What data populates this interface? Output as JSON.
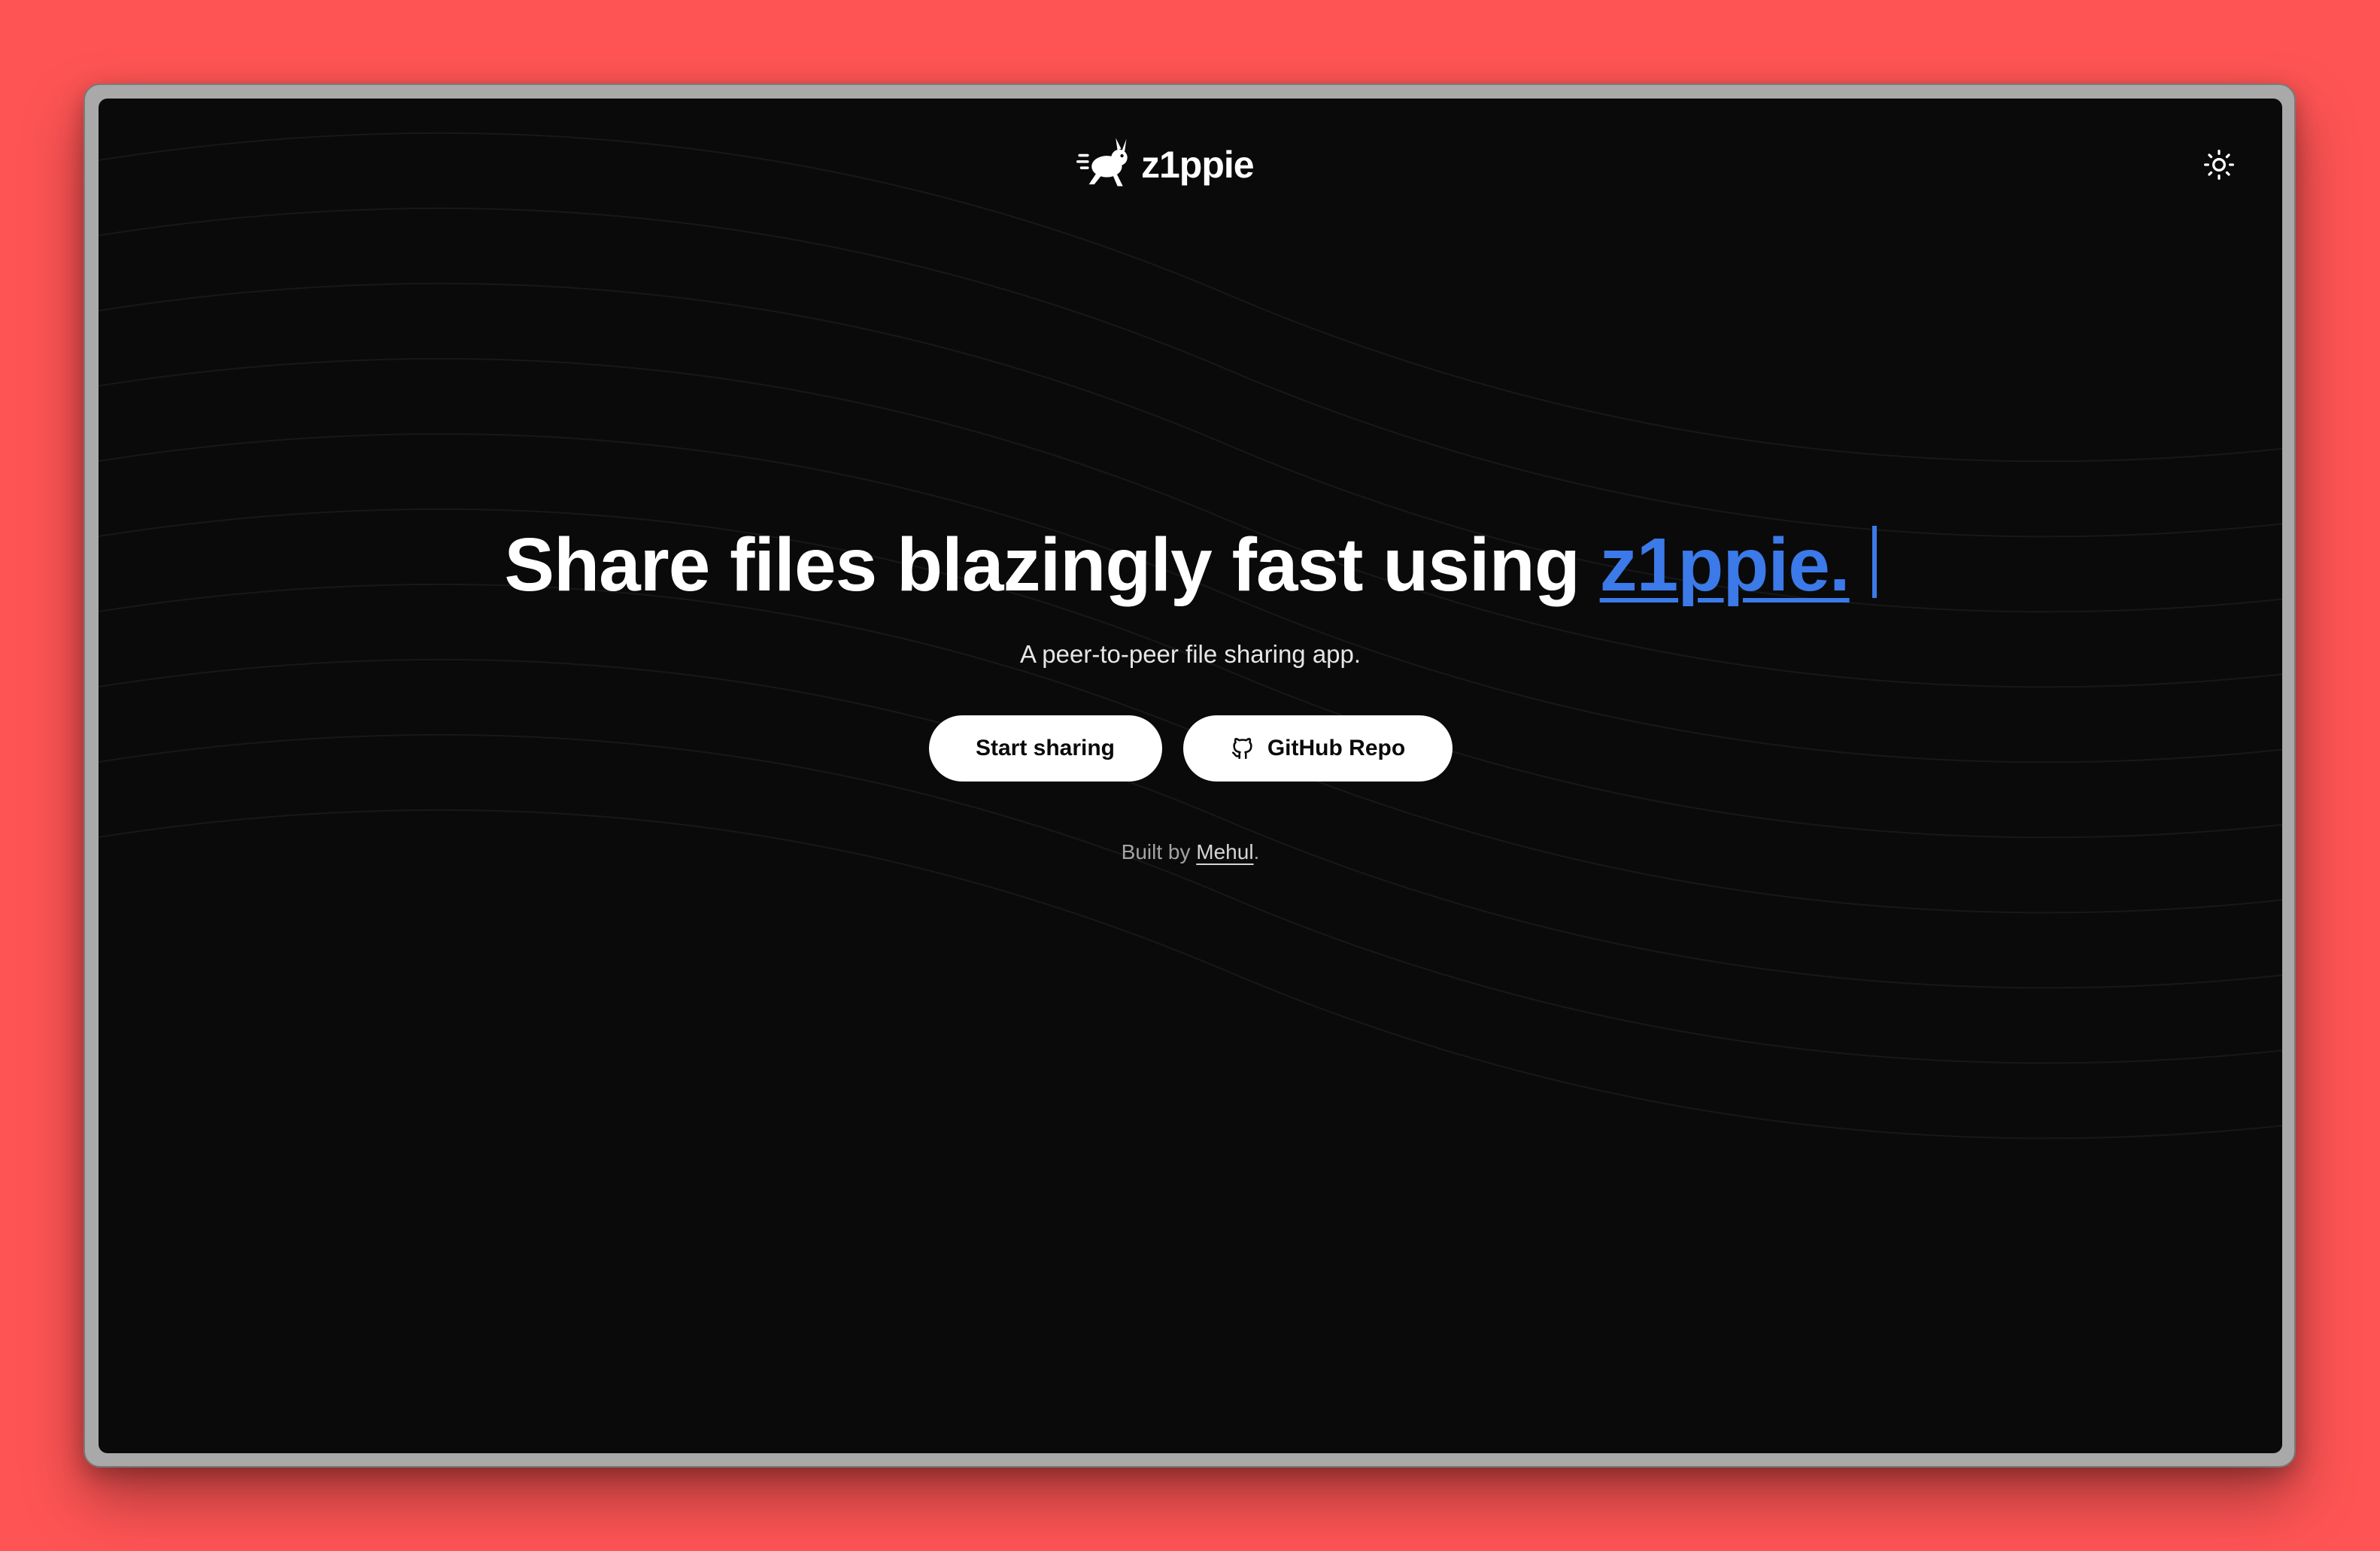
{
  "app": {
    "name": "z1ppie",
    "logo_icon": "running-rabbit-icon",
    "theme_toggle_icon": "sun-icon"
  },
  "hero": {
    "headline_prefix": "Share files blazingly fast using ",
    "headline_accent": "z1ppie.",
    "subtitle": "A peer-to-peer file sharing app."
  },
  "actions": {
    "start_label": "Start sharing",
    "github_label": "GitHub Repo",
    "github_icon": "github-icon"
  },
  "credit": {
    "prefix": "Built by ",
    "author": "Mehul",
    "suffix": "."
  },
  "colors": {
    "background": "#fe5454",
    "screen": "#0a0a0a",
    "accent": "#3b7ae8",
    "button_bg": "#ffffff"
  }
}
